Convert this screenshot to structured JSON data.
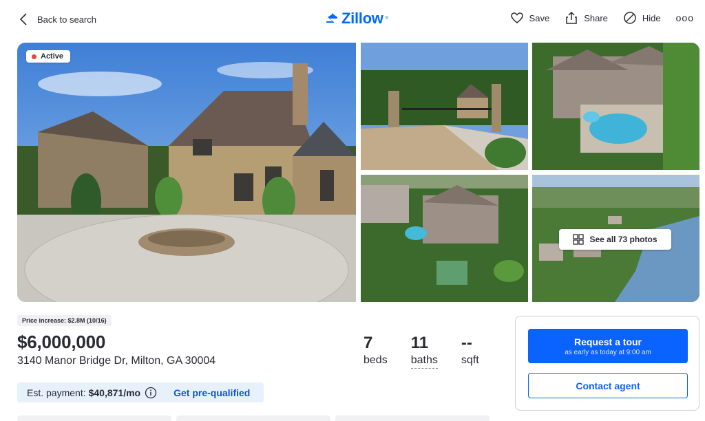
{
  "header": {
    "back_label": "Back to search",
    "logo_text": "Zillow",
    "logo_mark": "®",
    "save_label": "Save",
    "share_label": "Share",
    "hide_label": "Hide",
    "more_label": "ooo"
  },
  "gallery": {
    "status_badge": "Active",
    "see_all_label": "See all 73 photos",
    "photos": [
      "stone-house-front",
      "gated-driveway",
      "aerial-pool",
      "aerial-estate",
      "aerial-lake"
    ]
  },
  "listing": {
    "price_change": "Price increase: $2.8M (10/16)",
    "price": "$6,000,000",
    "address": "3140 Manor Bridge Dr, Milton, GA 30004",
    "beds": "7",
    "beds_label": "beds",
    "baths": "11",
    "baths_label": "baths",
    "sqft": "--",
    "sqft_label": "sqft",
    "est_payment_prefix": "Est. payment:",
    "est_payment_value": "$40,871/mo",
    "prequal_label": "Get pre-qualified"
  },
  "contact_card": {
    "tour_label": "Request a tour",
    "tour_sub": "as early as today at 9:00 am",
    "contact_label": "Contact agent"
  },
  "colors": {
    "brand": "#006aff",
    "primary_button": "#0a62ff",
    "active_dot": "#e8453c",
    "payment_bg": "#e7f1fc"
  }
}
